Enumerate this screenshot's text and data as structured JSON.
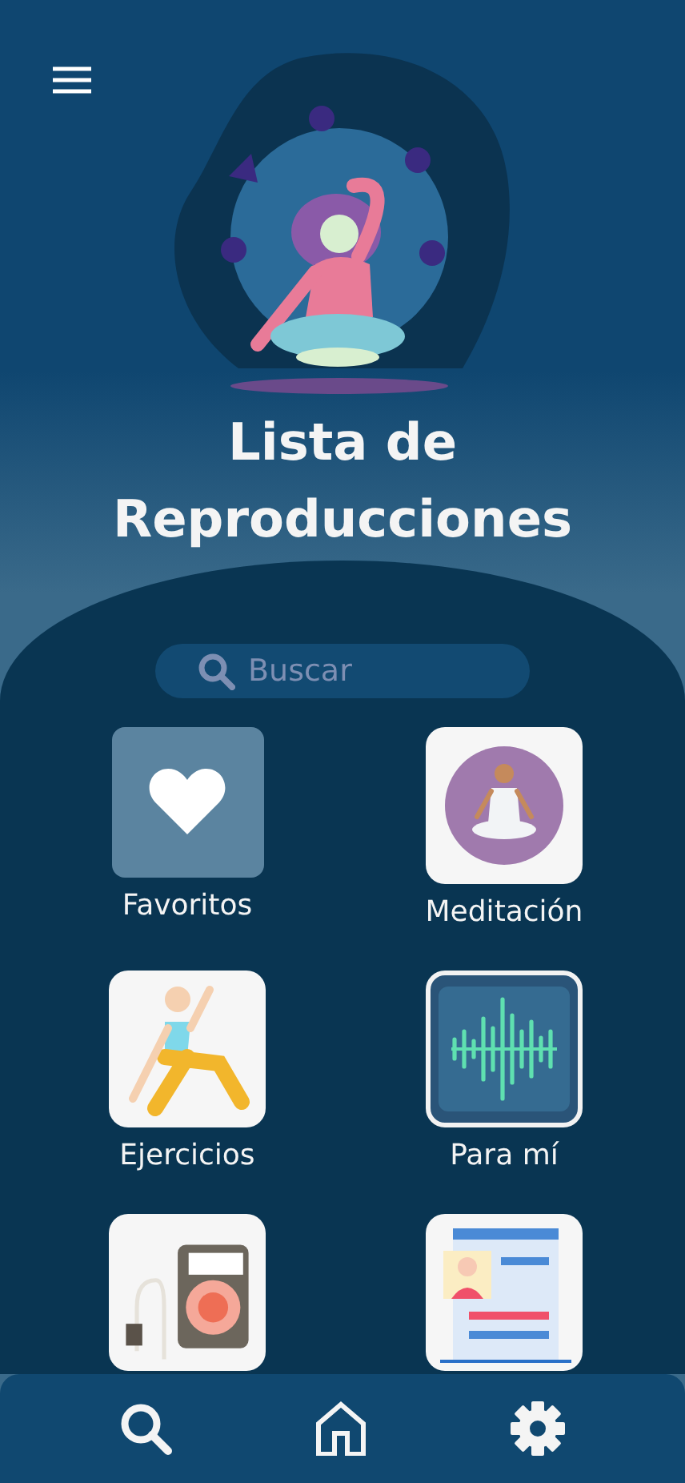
{
  "header": {
    "title": "Lista de Reproducciones"
  },
  "search": {
    "placeholder": "Buscar"
  },
  "playlists": [
    {
      "kind": "heart",
      "label": "Favoritos"
    },
    {
      "kind": "meditation",
      "label": "Meditación"
    },
    {
      "kind": "exercise",
      "label": "Ejercicios"
    },
    {
      "kind": "wave",
      "label": "Para mí"
    },
    {
      "kind": "player"
    },
    {
      "kind": "profile"
    }
  ],
  "bottom_nav": [
    {
      "kind": "search"
    },
    {
      "kind": "home"
    },
    {
      "kind": "settings"
    }
  ]
}
